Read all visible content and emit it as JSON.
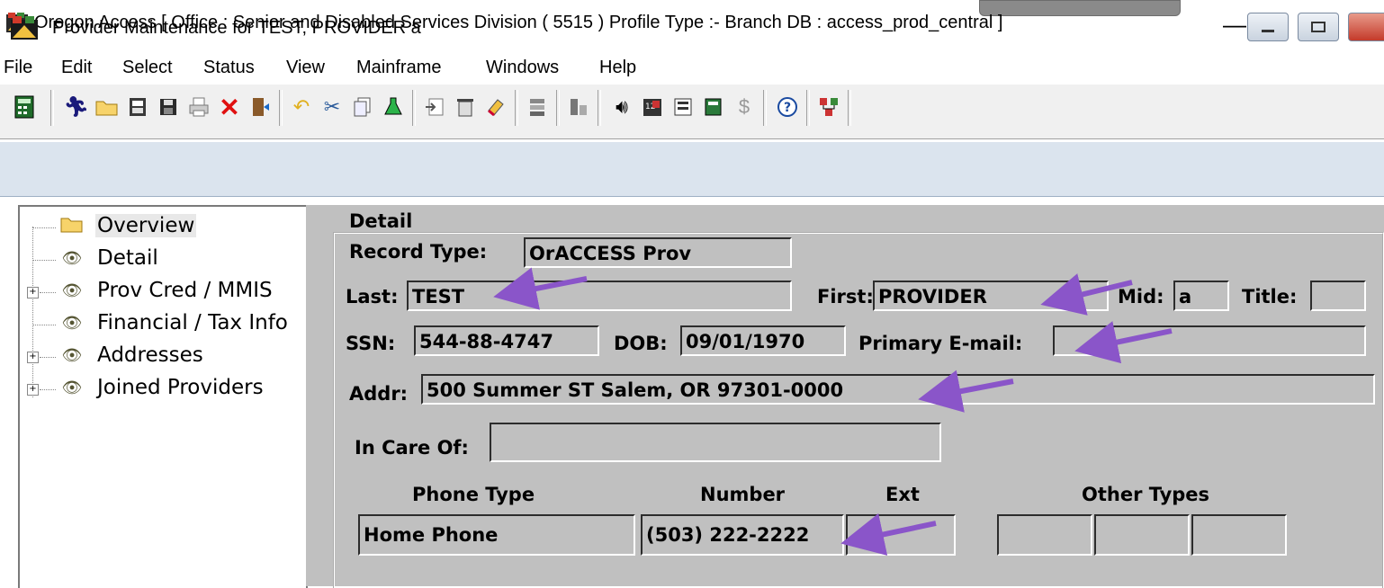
{
  "window": {
    "title": "Oregon Access [ Office : Senior and Disabled Services Division ( 5515 ) Profile Type :- Branch DB : access_prod_central ]",
    "minimize_label": "—"
  },
  "menu": [
    "File",
    "Edit",
    "Select",
    "Status",
    "View",
    "Mainframe",
    "Windows",
    "Help"
  ],
  "toolbar": {
    "buttons": [
      "calculator-icon",
      "runner-icon",
      "open-folder-icon",
      "phone-book-icon",
      "save-disk-icon",
      "print-icon",
      "delete-x-icon",
      "exit-door-icon",
      "undo-arrow-icon",
      "scissors-icon",
      "copy-doc-icon",
      "flask-icon",
      "import-icon",
      "trash-icon",
      "eraser-icon",
      "stack-icon",
      "lookup-icon",
      "speaker-icon",
      "calendar-icon",
      "form-icon",
      "book-icon",
      "dollar-icon",
      "help-icon",
      "network-icon"
    ]
  },
  "child_window": {
    "title": "Provider Maintenance for TEST, PROVIDER a"
  },
  "tree": {
    "items": [
      {
        "label": "Overview",
        "icon": "open-folder-icon",
        "expandable": false,
        "selected": true
      },
      {
        "label": "Detail",
        "icon": "eye-icon",
        "expandable": false
      },
      {
        "label": "Prov Cred / MMIS",
        "icon": "eye-icon",
        "expandable": true
      },
      {
        "label": "Financial / Tax Info",
        "icon": "eye-icon",
        "expandable": false
      },
      {
        "label": "Addresses",
        "icon": "eye-icon",
        "expandable": true
      },
      {
        "label": "Joined Providers",
        "icon": "eye-icon",
        "expandable": true
      }
    ]
  },
  "detail": {
    "group_label": "Detail",
    "record_type_label": "Record Type:",
    "record_type": "OrACCESS Prov",
    "last_label": "Last:",
    "last": "TEST",
    "first_label": "First:",
    "first": "PROVIDER",
    "mid_label": "Mid:",
    "mid": "a",
    "title_label": "Title:",
    "title": "",
    "ssn_label": "SSN:",
    "ssn": "544-88-4747",
    "dob_label": "DOB:",
    "dob": "09/01/1970",
    "email_label": "Primary E-mail:",
    "email": "",
    "addr_label": "Addr:",
    "addr": "500 Summer ST Salem, OR 97301-0000",
    "care_of_label": "In Care Of:",
    "care_of": "",
    "phone_type_header": "Phone Type",
    "number_header": "Number",
    "ext_header": "Ext",
    "other_types_header": "Other Types",
    "phone_type": "Home Phone",
    "phone_number": "(503) 222-2222",
    "ext": "",
    "other_types": [
      "",
      "",
      ""
    ]
  },
  "annotation_color": "#8a55c9"
}
